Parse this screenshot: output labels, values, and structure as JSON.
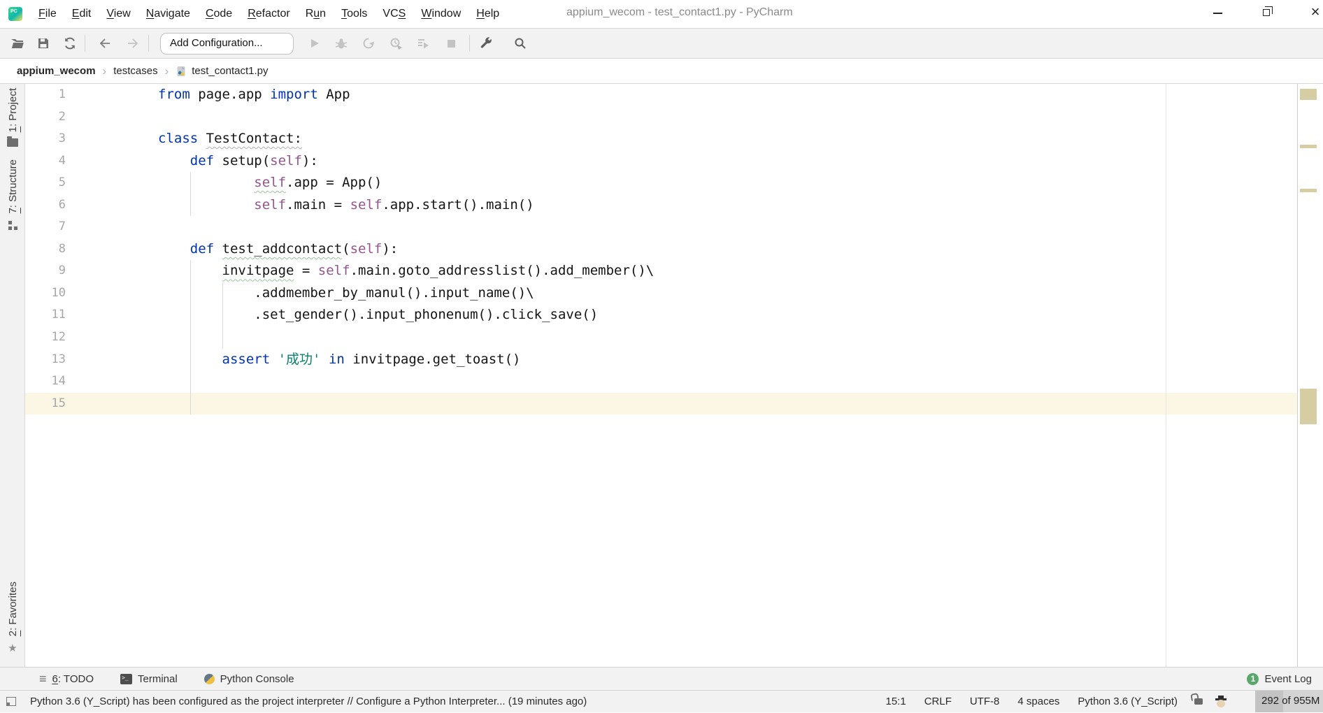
{
  "titlebar": {
    "title": "appium_wecom - test_contact1.py - PyCharm",
    "menus": [
      {
        "pre": "",
        "u": "F",
        "post": "ile"
      },
      {
        "pre": "",
        "u": "E",
        "post": "dit"
      },
      {
        "pre": "",
        "u": "V",
        "post": "iew"
      },
      {
        "pre": "",
        "u": "N",
        "post": "avigate"
      },
      {
        "pre": "",
        "u": "C",
        "post": "ode"
      },
      {
        "pre": "",
        "u": "R",
        "post": "efactor"
      },
      {
        "pre": "R",
        "u": "u",
        "post": "n"
      },
      {
        "pre": "",
        "u": "T",
        "post": "ools"
      },
      {
        "pre": "VC",
        "u": "S",
        "post": ""
      },
      {
        "pre": "",
        "u": "W",
        "post": "indow"
      },
      {
        "pre": "",
        "u": "H",
        "post": "elp"
      }
    ]
  },
  "toolbar": {
    "add_configuration_label": "Add Configuration...",
    "icons": [
      "open",
      "save",
      "sync",
      "back",
      "forward",
      "run",
      "debug",
      "rerun-coverage",
      "profile",
      "run-with",
      "stop",
      "wrench",
      "search"
    ]
  },
  "breadcrumb": {
    "items": [
      "appium_wecom",
      "testcases",
      "test_contact1.py"
    ]
  },
  "left_stripe": {
    "project": {
      "u": "1",
      "rest": ": Project"
    },
    "structure": {
      "u": "7",
      "rest": ": Structure"
    },
    "favorites": {
      "u": "2",
      "rest": ": Favorites"
    }
  },
  "editor": {
    "lines": [
      {
        "n": "1",
        "parts": [
          [
            "kw",
            "from"
          ],
          [
            "pl",
            " page.app "
          ],
          [
            "kw",
            "import"
          ],
          [
            "pl",
            " App"
          ]
        ]
      },
      {
        "n": "2",
        "parts": []
      },
      {
        "n": "3",
        "parts": [
          [
            "kw",
            "class"
          ],
          [
            "pl",
            " "
          ],
          [
            "tg",
            "TestContact:"
          ]
        ]
      },
      {
        "n": "4",
        "parts": [
          [
            "pl",
            "    "
          ],
          [
            "kw",
            "def"
          ],
          [
            "pl",
            " setup("
          ],
          [
            "self",
            "self"
          ],
          [
            "pl",
            "):"
          ]
        ]
      },
      {
        "n": "5",
        "parts": [
          [
            "pl",
            "            "
          ],
          [
            "selfw",
            "self"
          ],
          [
            "pl",
            ".app = App()"
          ]
        ]
      },
      {
        "n": "6",
        "parts": [
          [
            "pl",
            "            "
          ],
          [
            "self",
            "self"
          ],
          [
            "pl",
            ".main = "
          ],
          [
            "self",
            "self"
          ],
          [
            "pl",
            ".app.start().main()"
          ]
        ]
      },
      {
        "n": "7",
        "parts": []
      },
      {
        "n": "8",
        "parts": [
          [
            "pl",
            "    "
          ],
          [
            "kw",
            "def"
          ],
          [
            "pl",
            " "
          ],
          [
            "tw",
            "test_addcontact"
          ],
          [
            "pl",
            "("
          ],
          [
            "self",
            "self"
          ],
          [
            "pl",
            "):"
          ]
        ]
      },
      {
        "n": "9",
        "parts": [
          [
            "pl",
            "        "
          ],
          [
            "tw",
            "invitpage"
          ],
          [
            "pl",
            " = "
          ],
          [
            "self",
            "self"
          ],
          [
            "pl",
            ".main.goto_addresslist().add_member()\\"
          ]
        ]
      },
      {
        "n": "10",
        "parts": [
          [
            "pl",
            "            .addmember_by_manul().input_name()\\"
          ]
        ]
      },
      {
        "n": "11",
        "parts": [
          [
            "pl",
            "            .set_gender().input_phonenum().click_save()"
          ]
        ]
      },
      {
        "n": "12",
        "parts": []
      },
      {
        "n": "13",
        "parts": [
          [
            "pl",
            "        "
          ],
          [
            "kw",
            "assert"
          ],
          [
            "pl",
            " "
          ],
          [
            "str",
            "'成功'"
          ],
          [
            "pl",
            " "
          ],
          [
            "kw",
            "in"
          ],
          [
            "pl",
            " invitpage.get_toast()"
          ]
        ]
      },
      {
        "n": "14",
        "parts": []
      },
      {
        "n": "15",
        "parts": []
      }
    ]
  },
  "bottom_bar": {
    "todo": {
      "u": "6",
      "rest": ": TODO"
    },
    "terminal_label": "Terminal",
    "python_console_label": "Python Console"
  },
  "event_log": {
    "count": "1",
    "label": "Event Log"
  },
  "status_bar": {
    "message": "Python 3.6 (Y_Script) has been configured as the project interpreter // Configure a Python Interpreter... (19 minutes ago)",
    "caret_position": "15:1",
    "line_ending": "CRLF",
    "encoding": "UTF-8",
    "indent": "4 spaces",
    "interpreter": "Python 3.6 (Y_Script)",
    "memory": "292 of 955M"
  },
  "colors": {
    "keyword": "#0033b3",
    "self_param": "#94558d",
    "string": "#0b7f6b",
    "caret_row": "#fbf7e4",
    "stripe_mark": "#d6cda2",
    "event_badge": "#59a869"
  }
}
